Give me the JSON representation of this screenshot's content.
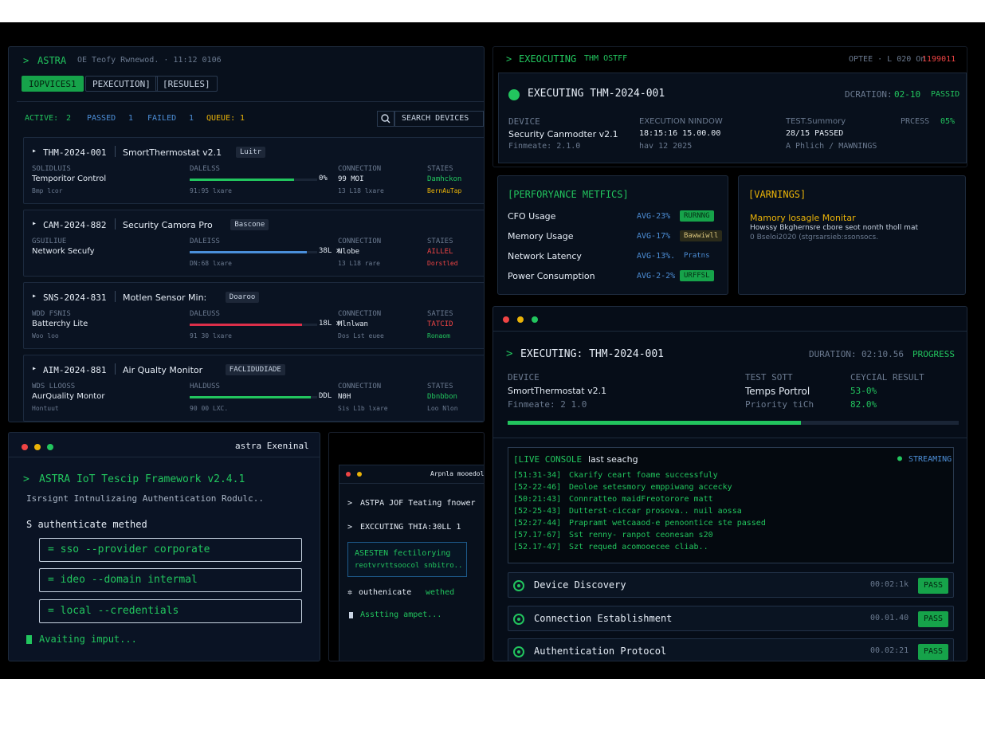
{
  "left_top": {
    "brand": "ASTRA",
    "subtitle": "OE Teofy Rwnewod. · 11:12 0106",
    "tabs": [
      "IOPVICES1",
      "PEXECUTION]",
      "[RESULES]"
    ],
    "stats": {
      "active_label": "ACTIVE:",
      "active_val": "2",
      "passed_label": "PASSED",
      "passed_val": "1",
      "failed_label": "FAILED",
      "failed_val": "1",
      "queue_label": "QUEUE:",
      "queue_val": "1"
    },
    "search_placeholder": "SEARCH DEVICES",
    "devices": [
      {
        "id": "THM-2024-001",
        "name": "SmortThermostat v2.1",
        "tag": "Luitr",
        "cat": "SOLIDLUIS",
        "sub": "Temporitor Control",
        "meta": "Bmp lcor",
        "prog_label": "DALELSS",
        "prog_pct": "0%",
        "prog_time": "91:95 lxare",
        "progress": 0.82,
        "bar_color": "#22c55e",
        "conn_label": "CONNECTION",
        "conn_val": "99 MOI",
        "conn_sub": "13 L18 lxare",
        "status_label": "STAIES",
        "status_val": "Damhckon",
        "status_sub": "BernAuTap",
        "status_color": "#22c55e",
        "status_sub_color": "#eab308"
      },
      {
        "id": "CAM-2024-882",
        "name": "Security Camora Pro",
        "tag": "Bascone",
        "cat": "GSUILIUE",
        "sub": "Network Secufy",
        "meta": "",
        "prog_label": "DALEISS",
        "prog_pct": "38L x",
        "prog_time": "DN:68 lxare",
        "progress": 0.92,
        "bar_color": "#4a8fdb",
        "conn_label": "CONNECTION",
        "conn_val": "Nlobe",
        "conn_sub": "13 L18 rare",
        "status_label": "STAIES",
        "status_val": "AILLEL",
        "status_sub": "Dorstled",
        "status_color": "#ef4444",
        "status_sub_color": "#ef4444"
      },
      {
        "id": "SNS-2024-831",
        "name": "Motlen Sensor Min:",
        "tag": "Doaroo",
        "cat": "WDD FSNIS",
        "sub": "Batterchy Lite",
        "meta": "Woo loo",
        "prog_label": "DALEUSS",
        "prog_pct": "18L x",
        "prog_time": "91 30 lxare",
        "progress": 0.88,
        "bar_color": "#dc2f4a",
        "conn_label": "CONNECTION",
        "conn_val": "Mlnlwan",
        "conn_sub": "Dos Lst euee",
        "status_label": "SATIES",
        "status_val": "TATCID",
        "status_sub": "Ronaom",
        "status_color": "#ef4444",
        "status_sub_color": "#22c55e"
      },
      {
        "id": "AIM-2024-881",
        "name": "Air Qualty Monitor",
        "tag": "FACLIDUDIADE",
        "cat": "WDS LLOOSS",
        "sub": "AurQuality Montor",
        "meta": "Hontuut",
        "prog_label": "HALDUSS",
        "prog_pct": "DDL",
        "prog_time": "90 00 LXC.",
        "progress": 0.95,
        "bar_color": "#22c55e",
        "conn_label": "CONNECTION",
        "conn_val": "N0H",
        "conn_sub": "Sis L1b lxare",
        "status_label": "STATES",
        "status_val": "Dbnbbon",
        "status_sub": "Loo Nlon",
        "status_color": "#22c55e",
        "status_sub_color": "#6b7a90"
      }
    ]
  },
  "top_right": {
    "header": "EXEOCUTING",
    "header_sub": "THM OSTFF",
    "header_right_a": "OPTEE  · L 020 On",
    "header_right_b": "1199011",
    "exec_title": "EXECUTING  THM-2024-001",
    "duration_label": "DCRATION:",
    "duration_val": "02-10",
    "duration_status": "PASSID",
    "device_label": "DEVICE",
    "device_val": "Security Canmodter v2.1",
    "device_fw": "Finmeate: 2.1.0",
    "window_label": "EXECUTION NINDOW",
    "window_val": "18:15:16  15.00.00",
    "window_sub": "hav 12   2025",
    "summary_label": "TEST.Summory",
    "summary_val": "28/15 PASSED",
    "summary_sub": "A Phlich / MAWNINGS",
    "process_label": "PRCESS",
    "process_val": "05%"
  },
  "perf": {
    "title": "[PERFORYANCE METFICS]",
    "rows": [
      {
        "label": "CFO Usage",
        "avg": "AVG-23%",
        "badge": "RURNNG",
        "badge_bg": "#16a34a",
        "badge_fg": "#052e14"
      },
      {
        "label": "Memory Usage",
        "avg": "AVG-17%",
        "badge": "Bawwiwll",
        "badge_bg": "#2b2b1a",
        "badge_fg": "#d4c07a"
      },
      {
        "label": "Network Latency",
        "avg": "AVG-13%.",
        "badge": "Pratns",
        "badge_bg": "transparent",
        "badge_fg": "#4d8fd8"
      },
      {
        "label": "Power Consumption",
        "avg": "AVG-2-2%",
        "badge": "URFFSL",
        "badge_bg": "#16a34a",
        "badge_fg": "#052e14"
      }
    ]
  },
  "warnings": {
    "title": "[VARNINGS]",
    "item_title": "Mamory losagle Monitar",
    "item_line1": "Howssy Bkghernsre cbore seot nonth tholl mat",
    "item_line2": "0 Bseloi2020 (stgrsarsieb:ssonsocs."
  },
  "exec_main": {
    "title": "EXECUTING: THM-2024-001",
    "duration_label": "DURATION:",
    "duration_val": "02:10.56",
    "progress_label": "PROGRESS",
    "device_label": "DEVICE",
    "device_val": "SmortThermostat v2.1",
    "device_fw": "Finmeate: 2 1.0",
    "suite_label": "TEST SOTT",
    "suite_val": "Temps  Portrol",
    "suite_sub": "Priority  tiCh",
    "result_label": "CEYCIAL RESULT",
    "result_val": "53-0%",
    "result_sub": "82.0%",
    "progress": 0.65
  },
  "console": {
    "title": "[LIVE CONSOLE",
    "title_sub": "last seachg",
    "streaming": "STREAMING",
    "lines": [
      {
        "ts": "[51:31-34]",
        "msg": "Ckarify ceart foame successfuly"
      },
      {
        "ts": "[52-22-46]",
        "msg": "Deoloe setesmory emppiwang accecky"
      },
      {
        "ts": "[50:21:43]",
        "msg": "Connratteo maidFreotorore matt"
      },
      {
        "ts": "[52-25-43]",
        "msg": "Dutterst-ciccar prosova.. nuil aossa"
      },
      {
        "ts": "[52:27-44]",
        "msg": "Prapramt wetcaaod-e penoontice ste passed"
      },
      {
        "ts": "[57.17-67]",
        "msg": "Sst renny- ranpot ceonesan s20"
      },
      {
        "ts": "[52.17-47]",
        "msg": "Szt requed acomooecee cliab.."
      }
    ]
  },
  "steps": [
    {
      "label": "Device Discovery",
      "time": "00:02:1k",
      "status": "PASS"
    },
    {
      "label": "Connection Establishment",
      "time": "00.01.40",
      "status": "PASS"
    },
    {
      "label": "Authentication Protocol",
      "time": "00.02:21",
      "status": "PASS"
    }
  ],
  "terminal_left": {
    "title": "astra Exeninal",
    "banner": "ASTRA IoT Tescip Framework v2.4.1",
    "init": "Isrsignt Intnulizaing Authentication Rodulc..",
    "prompt": "S authenticate  methed",
    "options": [
      "= sso --provider corporate",
      "= ideo --domain intermal",
      "= local --credentials"
    ],
    "waiting": "Avaiting imput..."
  },
  "terminal_mini": {
    "title": "Arpnla mooedol",
    "line1": "ASTPA JOF Teating fnower",
    "line2": "EXCCUTING THIA:30LL 1",
    "box_line1": "ASESTEN fectilorying",
    "box_line2": "reotvrvttsoocol snbitro..",
    "auth_cmd": "outhenicate",
    "auth_arg": "wethed",
    "waiting": "Asstting ampet..."
  }
}
